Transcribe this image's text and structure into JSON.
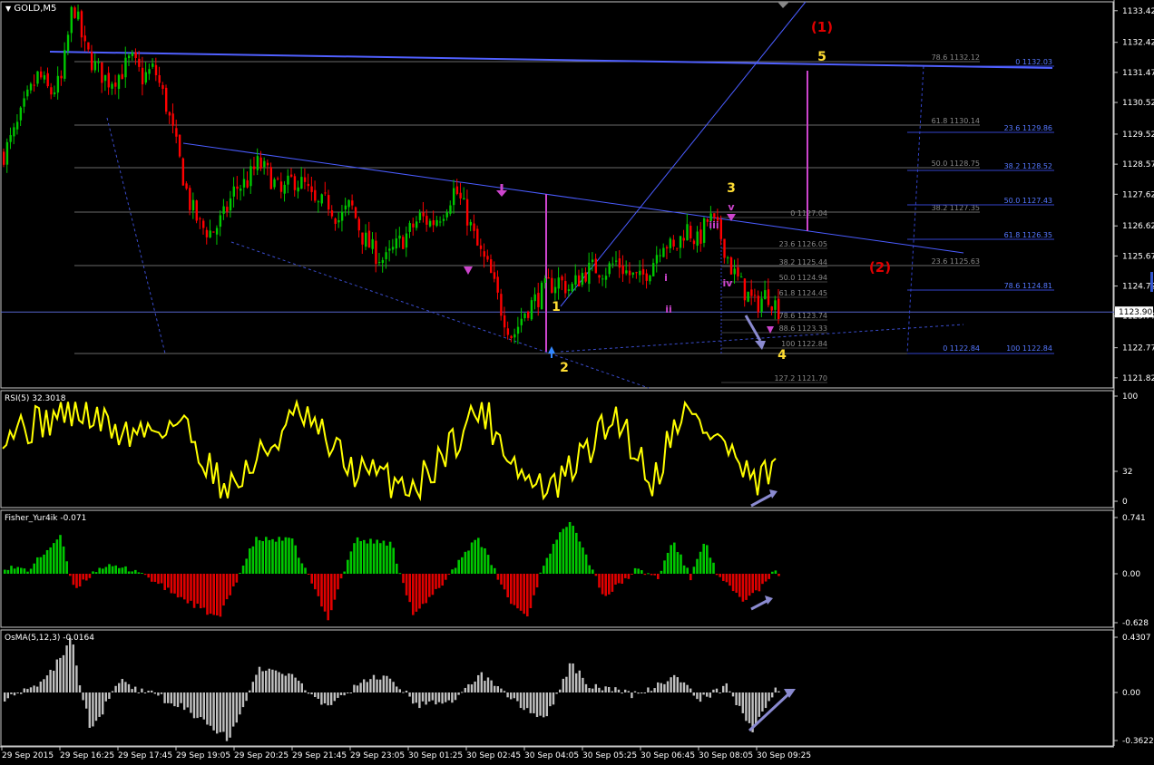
{
  "symbol_label": "GOLD,M5",
  "main": {
    "price_ticks": [
      "1133.42",
      "1132.42",
      "1131.47",
      "1130.52",
      "1129.52",
      "1128.57",
      "1127.62",
      "1126.62",
      "1125.67",
      "1124.72",
      "1123.77",
      "1122.77",
      "1121.82"
    ],
    "current_price": "1123.90",
    "fib_left": [
      "78.6 1132.12",
      "61.8 1130.14",
      "50.0 1128.75",
      "38.2 1127.35",
      "23.6 1125.63"
    ],
    "fib_mid": [
      "0 1127.04",
      "23.6 1126.05",
      "38.2 1125.44",
      "50.0 1124.94",
      "61.8 1124.45",
      "78.6 1123.74",
      "88.6 1123.33",
      "100 1122.84",
      "127.2 1121.70"
    ],
    "fib_right": [
      "0 1132.03",
      "23.6 1129.86",
      "38.2 1128.52",
      "50.0 1127.43",
      "61.8 1126.35",
      "78.6 1124.81",
      "0 1122.84",
      "100 1122.84"
    ],
    "wave_labels": {
      "w1": "(1)",
      "w2": "(2)",
      "y5": "5",
      "y3": "3",
      "y1": "1",
      "y2": "2",
      "y4": "4",
      "m_i": "i",
      "m_ii": "ii",
      "m_iii": "iii",
      "m_iv": "iv",
      "m_v": "v"
    }
  },
  "rsi": {
    "label": "RSI(5) 32.3018",
    "ticks": [
      "100",
      "32",
      "0"
    ]
  },
  "fisher": {
    "label": "Fisher_Yur4ik -0.071",
    "ticks": [
      "0.741",
      "0.00",
      "-0.628"
    ]
  },
  "osma": {
    "label": "OsMA(5,12,3) -0.0164",
    "ticks": [
      "0.4307",
      "0.00",
      "-0.3622"
    ]
  },
  "time_axis": [
    "29 Sep 2015",
    "29 Sep 16:25",
    "29 Sep 17:45",
    "29 Sep 19:05",
    "29 Sep 20:25",
    "29 Sep 21:45",
    "29 Sep 23:05",
    "30 Sep 01:25",
    "30 Sep 02:45",
    "30 Sep 04:05",
    "30 Sep 05:25",
    "30 Sep 06:45",
    "30 Sep 08:05",
    "30 Sep 09:25"
  ],
  "colors": {
    "up": "#00c800",
    "down": "#ff0000",
    "rsi": "#ffff00",
    "fisher_up": "#00c800",
    "fisher_down": "#e00000",
    "osma": "#c0c0c0",
    "trend": "#3c50ff",
    "fib": "#6a6a6a",
    "wave_yellow": "#ffdd33",
    "wave_magenta": "#cc44cc",
    "wave_red": "#e00000",
    "arrow": "#8a8ad0"
  },
  "chart_data": {
    "type": "candlestick",
    "symbol": "GOLD",
    "timeframe": "M5",
    "ylim": [
      1121.5,
      1133.7
    ],
    "x_start": "29 Sep 2015",
    "x_end": "30 Sep 09:25",
    "close_path": [
      1128.9,
      1129.6,
      1130.6,
      1131.4,
      1130.8,
      1131.2,
      1133.7,
      1132.2,
      1131.6,
      1131.2,
      1131.4,
      1131.9,
      1131.3,
      1131.6,
      1130.5,
      1129.0,
      1127.4,
      1126.6,
      1126.4,
      1126.9,
      1127.8,
      1128.0,
      1128.6,
      1128.2,
      1127.6,
      1128.1,
      1127.9,
      1127.2,
      1127.4,
      1126.8,
      1127.3,
      1126.3,
      1125.8,
      1125.5,
      1126.0,
      1126.4,
      1126.9,
      1126.7,
      1127.1,
      1127.8,
      1127.0,
      1125.9,
      1125.2,
      1124.0,
      1123.1,
      1123.9,
      1124.3,
      1124.7,
      1124.9,
      1124.6,
      1125.1,
      1125.3,
      1125.2,
      1125.5,
      1125.1,
      1124.9,
      1125.4,
      1126.2,
      1125.8,
      1126.6,
      1126.1,
      1126.9,
      1126.3,
      1125.2,
      1124.6,
      1124.1,
      1124.5,
      1124.0
    ],
    "last_price": 1123.9,
    "rsi": {
      "name": "RSI(5)",
      "last": 32.3018,
      "ylim": [
        0,
        100
      ],
      "level": 32
    },
    "fisher": {
      "name": "Fisher_Yur4ik",
      "last": -0.071,
      "ylim": [
        -0.628,
        0.741
      ]
    },
    "osma": {
      "name": "OsMA(5,12,3)",
      "last": -0.0164,
      "ylim": [
        -0.3622,
        0.4307
      ]
    }
  }
}
